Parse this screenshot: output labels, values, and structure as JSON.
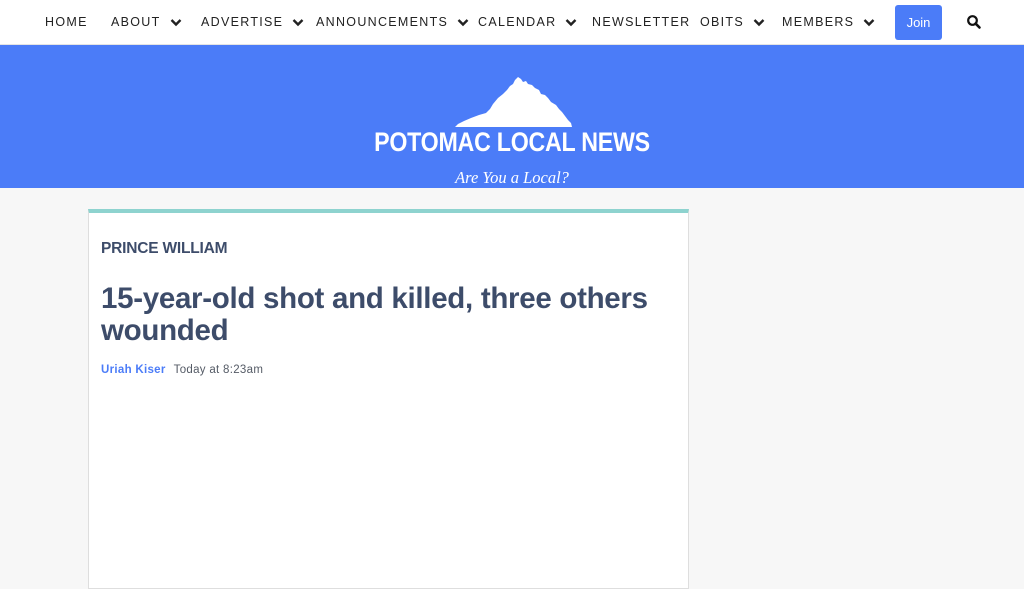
{
  "nav": {
    "items": [
      {
        "label": "HOME",
        "dropdown": false
      },
      {
        "label": "ABOUT",
        "dropdown": true
      },
      {
        "label": "ADVERTISE",
        "dropdown": true
      },
      {
        "label": "ANNOUNCEMENTS",
        "dropdown": true
      },
      {
        "label": "CALENDAR",
        "dropdown": true
      },
      {
        "label": "NEWSLETTER",
        "dropdown": false
      },
      {
        "label": "OBITS",
        "dropdown": true
      },
      {
        "label": "MEMBERS",
        "dropdown": true
      }
    ],
    "join_label": "Join",
    "search_icon": "search-icon"
  },
  "masthead": {
    "logo_text": "POTOMAC LOCAL NEWS",
    "tagline": "Are You a Local?",
    "logo_icon": "virginia-state-icon"
  },
  "article": {
    "category": "PRINCE WILLIAM",
    "headline": "15-year-old shot and killed, three others wounded",
    "author": "Uriah Kiser",
    "timestamp": "Today at 8:23am"
  },
  "colors": {
    "brand_blue": "#4b7cf8",
    "heading": "#3d4c6a",
    "card_accent": "#8ed3cf",
    "page_bg": "#f7f7f7"
  }
}
